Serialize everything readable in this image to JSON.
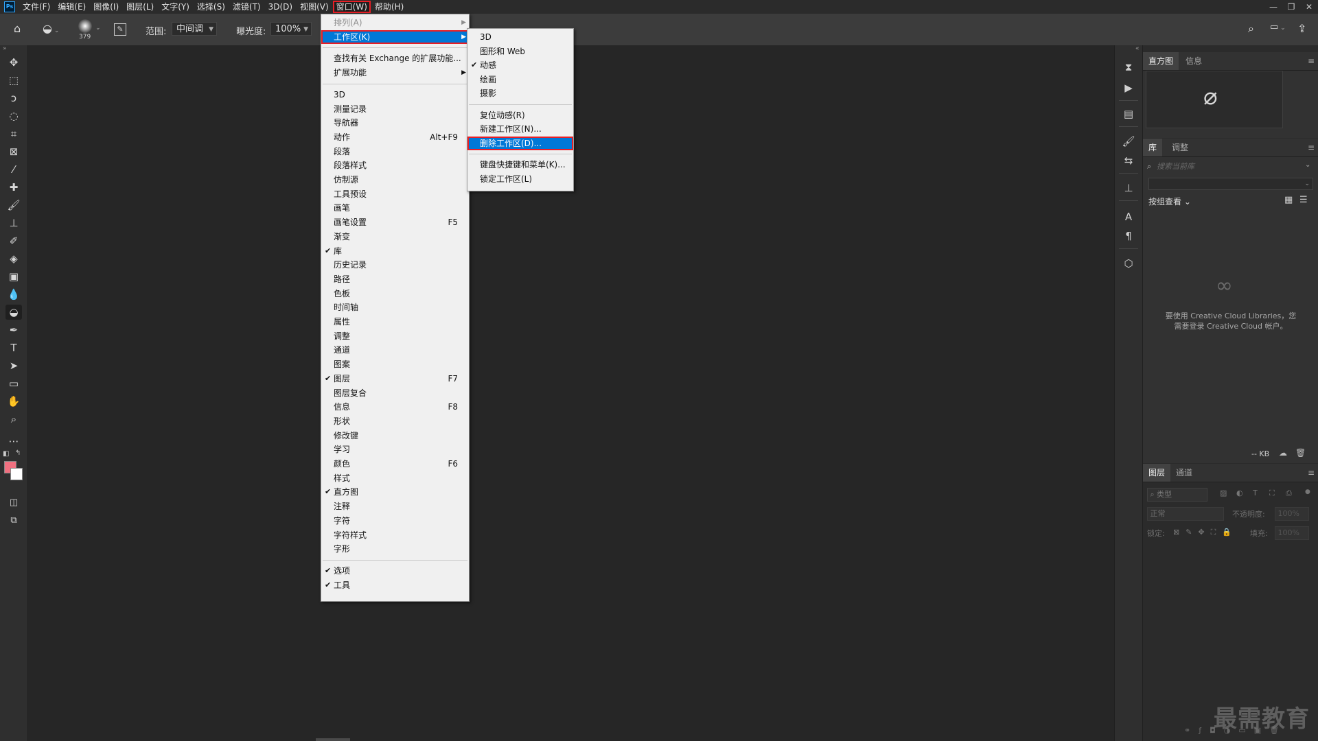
{
  "app": {
    "logo": "Ps"
  },
  "menubar": {
    "items": [
      "文件(F)",
      "编辑(E)",
      "图像(I)",
      "图层(L)",
      "文字(Y)",
      "选择(S)",
      "滤镜(T)",
      "3D(D)",
      "视图(V)",
      "窗口(W)",
      "帮助(H)"
    ],
    "active_index": 9
  },
  "window_controls": {
    "minimize": "—",
    "restore": "❐",
    "close": "✕"
  },
  "options": {
    "brush_size": "379",
    "range_label": "范围:",
    "range_value": "中间调",
    "exposure_label": "曝光度:",
    "exposure_value": "100%"
  },
  "tool_icons": [
    "move-icon",
    "marquee-icon",
    "lasso-icon",
    "quick-select-icon",
    "crop-icon",
    "frame-icon",
    "eyedropper-icon",
    "healing-icon",
    "brush-icon",
    "stamp-icon",
    "history-brush-icon",
    "eraser-icon",
    "gradient-icon",
    "blur-icon",
    "dodge-icon",
    "pen-icon",
    "type-icon",
    "path-select-icon",
    "rectangle-icon",
    "hand-icon",
    "zoom-icon",
    "more-icon"
  ],
  "colors": {
    "foreground": "#f07080",
    "background": "#ffffff",
    "highlight": "#0078d7",
    "outline": "#e81e25"
  },
  "window_menu": {
    "items": [
      {
        "label": "排列(A)",
        "disabled": true,
        "submenu": true
      },
      {
        "label": "工作区(K)",
        "submenu": true,
        "highlight": true
      },
      {
        "sep": true
      },
      {
        "label": "查找有关 Exchange 的扩展功能..."
      },
      {
        "label": "扩展功能",
        "submenu": true
      },
      {
        "sep": true
      },
      {
        "label": "3D"
      },
      {
        "label": "测量记录"
      },
      {
        "label": "导航器"
      },
      {
        "label": "动作",
        "key": "Alt+F9"
      },
      {
        "label": "段落"
      },
      {
        "label": "段落样式"
      },
      {
        "label": "仿制源"
      },
      {
        "label": "工具预设"
      },
      {
        "label": "画笔"
      },
      {
        "label": "画笔设置",
        "key": "F5"
      },
      {
        "label": "渐变"
      },
      {
        "label": "库",
        "checked": true
      },
      {
        "label": "历史记录"
      },
      {
        "label": "路径"
      },
      {
        "label": "色板"
      },
      {
        "label": "时间轴"
      },
      {
        "label": "属性"
      },
      {
        "label": "调整"
      },
      {
        "label": "通道"
      },
      {
        "label": "图案"
      },
      {
        "label": "图层",
        "checked": true,
        "key": "F7"
      },
      {
        "label": "图层复合"
      },
      {
        "label": "信息",
        "key": "F8"
      },
      {
        "label": "形状"
      },
      {
        "label": "修改键"
      },
      {
        "label": "学习"
      },
      {
        "label": "颜色",
        "key": "F6"
      },
      {
        "label": "样式"
      },
      {
        "label": "直方图",
        "checked": true
      },
      {
        "label": "注释"
      },
      {
        "label": "字符"
      },
      {
        "label": "字符样式"
      },
      {
        "label": "字形"
      },
      {
        "sep": true
      },
      {
        "label": "选项",
        "checked": true
      },
      {
        "label": "工具",
        "checked": true
      }
    ]
  },
  "workspace_menu": {
    "items": [
      {
        "label": "3D"
      },
      {
        "label": "图形和 Web"
      },
      {
        "label": "动感",
        "checked": true
      },
      {
        "label": "绘画"
      },
      {
        "label": "摄影"
      },
      {
        "sep": true
      },
      {
        "label": "复位动感(R)"
      },
      {
        "label": "新建工作区(N)..."
      },
      {
        "label": "删除工作区(D)...",
        "highlight": true
      },
      {
        "sep": true
      },
      {
        "label": "键盘快捷键和菜单(K)..."
      },
      {
        "label": "锁定工作区(L)"
      }
    ]
  },
  "panels": {
    "histogram": {
      "tabs": [
        "直方图",
        "信息"
      ],
      "empty_symbol": "⌀"
    },
    "library": {
      "tabs": [
        "库",
        "调整"
      ],
      "search_placeholder": "搜索当前库",
      "view_label": "按组查看",
      "message_line1": "要使用 Creative Cloud Libraries，您",
      "message_line2": "需要登录 Creative Cloud 帐户。",
      "size": "-- KB"
    },
    "layers": {
      "tabs": [
        "图层",
        "通道"
      ],
      "filter_label": "类型",
      "blend_mode": "正常",
      "opacity_label": "不透明度:",
      "opacity_value": "100%",
      "lock_label": "锁定:",
      "fill_label": "填充:",
      "fill_value": "100%"
    }
  },
  "watermark": "最需教育"
}
